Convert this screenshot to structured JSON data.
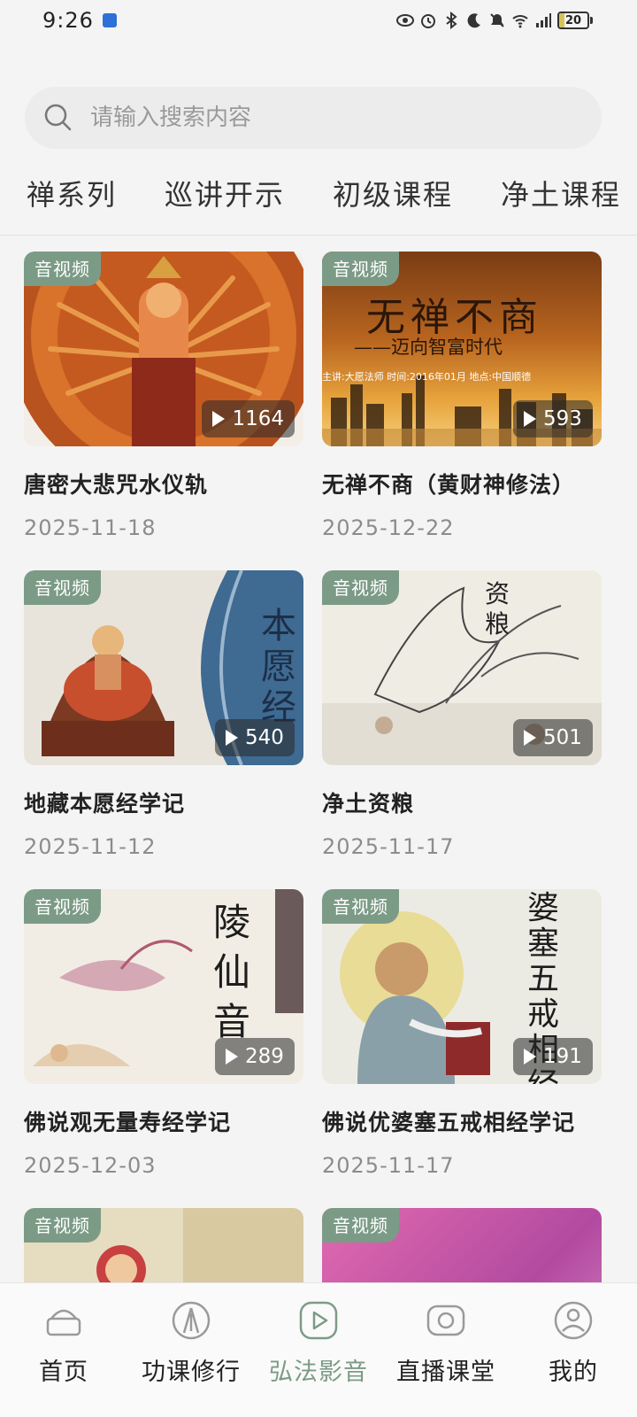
{
  "status_bar": {
    "time": "9:26",
    "battery": "20",
    "battery_level": 0.2,
    "network": "4G"
  },
  "search": {
    "placeholder": "请输入搜索内容"
  },
  "tabs": [
    "禅系列",
    "巡讲开示",
    "初级课程",
    "净土课程"
  ],
  "accent_color": "#7c9b86",
  "cards": [
    {
      "badge": "音视频",
      "title": "唐密大悲咒水仪轨",
      "date": "2025-11-18",
      "play_count": "1164"
    },
    {
      "badge": "音视频",
      "title": "无禅不商（黄财神修法）",
      "date": "2025-12-22",
      "play_count": "593",
      "thumb_text": {
        "main": "无禅不商",
        "sub": "——迈向智富时代",
        "info": "主讲:大愿法师   时间:2016年01月   地点:中国顺德"
      }
    },
    {
      "badge": "音视频",
      "title": "地藏本愿经学记",
      "date": "2025-11-12",
      "play_count": "540",
      "thumb_text": {
        "main": "本愿经"
      }
    },
    {
      "badge": "音视频",
      "title": "净土资粮",
      "date": "2025-11-17",
      "play_count": "501",
      "thumb_text": {
        "main": "资粮"
      }
    },
    {
      "badge": "音视频",
      "title": "佛说观无量寿经学记",
      "date": "2025-12-03",
      "play_count": "289",
      "thumb_text": {
        "main": "陵仙音"
      }
    },
    {
      "badge": "音视频",
      "title": "佛说优婆塞五戒相经学记",
      "date": "2025-11-17",
      "play_count": "191",
      "thumb_text": {
        "main": "婆塞五戒相经学"
      }
    },
    {
      "badge": "音视频"
    },
    {
      "badge": "音视频"
    }
  ],
  "bottom_nav": [
    {
      "label": "首页",
      "icon": "home-icon"
    },
    {
      "label": "功课修行",
      "icon": "practice-icon"
    },
    {
      "label": "弘法影音",
      "icon": "play-icon",
      "active": true
    },
    {
      "label": "直播课堂",
      "icon": "live-icon"
    },
    {
      "label": "我的",
      "icon": "profile-icon"
    }
  ]
}
